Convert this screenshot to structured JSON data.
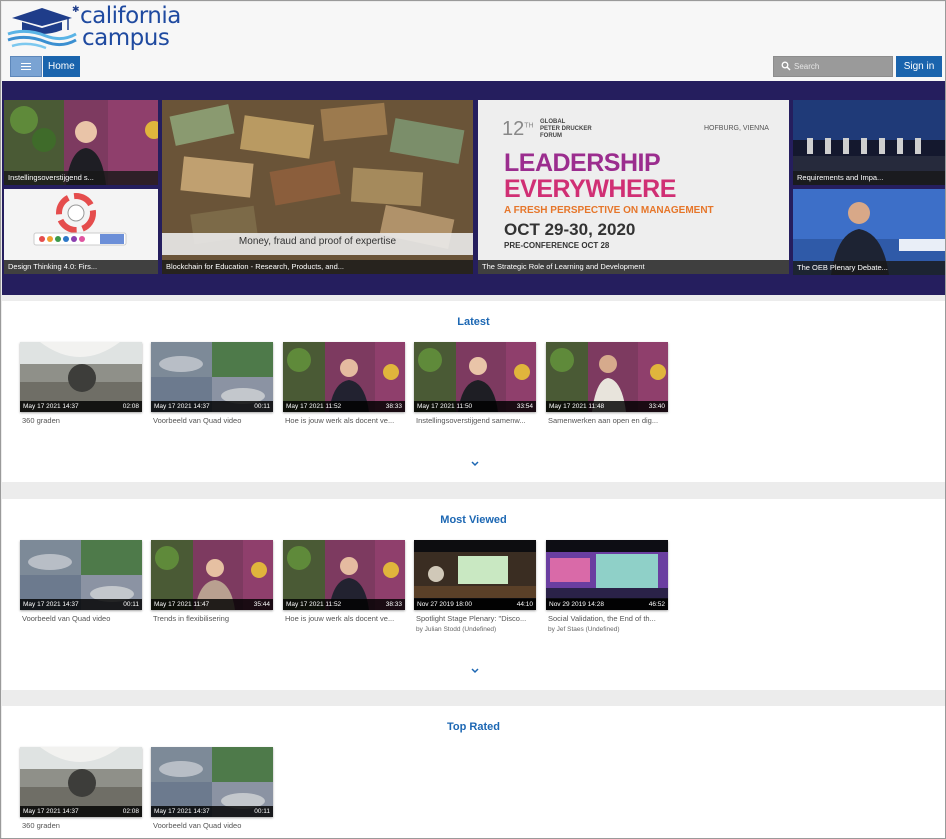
{
  "brand": {
    "line1": "california",
    "line2": "campus"
  },
  "nav": {
    "home": "Home",
    "sign_in": "Sign in",
    "search_placeholder": "Search"
  },
  "hero": {
    "tiles": [
      {
        "caption": "Instellingsoverstijgend s..."
      },
      {
        "caption": "Design Thinking 4.0: Firs..."
      },
      {
        "caption": "Blockchain for Education - Research, Products, and...",
        "overlay": "Money, fraud and proof of expertise"
      },
      {
        "caption": "The Strategic Role of Learning and Development",
        "poster": {
          "number": "12",
          "superscript": "TH",
          "org_lines": [
            "GLOBAL",
            "PETER DRUCKER",
            "FORUM"
          ],
          "location": "HOFBURG, VIENNA",
          "headline1": "LEADERSHIP",
          "headline2": "EVERYWHERE",
          "subhead": "A FRESH PERSPECTIVE ON MANAGEMENT",
          "dates": "OCT 29-30, 2020",
          "preconf": "PRE-CONFERENCE OCT 28"
        }
      },
      {
        "caption": "Requirements and Impa..."
      },
      {
        "caption": "The OEB Plenary Debate..."
      }
    ]
  },
  "sections": [
    {
      "title": "Latest",
      "cards": [
        {
          "date": "May 17 2021 14:37",
          "duration": "02:08",
          "title": "360 graden"
        },
        {
          "date": "May 17 2021 14:37",
          "duration": "00:11",
          "title": "Voorbeeld van Quad video"
        },
        {
          "date": "May 17 2021 11:52",
          "duration": "38:33",
          "title": "Hoe is jouw werk als docent ve..."
        },
        {
          "date": "May 17 2021 11:50",
          "duration": "33:54",
          "title": "Instellingsoverstijgend samenw..."
        },
        {
          "date": "May 17 2021 11:48",
          "duration": "33:40",
          "title": "Samenwerken aan open en dig..."
        }
      ]
    },
    {
      "title": "Most Viewed",
      "cards": [
        {
          "date": "May 17 2021 14:37",
          "duration": "00:11",
          "title": "Voorbeeld van Quad video"
        },
        {
          "date": "May 17 2021 11:47",
          "duration": "35:44",
          "title": "Trends in flexibilisering"
        },
        {
          "date": "May 17 2021 11:52",
          "duration": "38:33",
          "title": "Hoe is jouw werk als docent ve..."
        },
        {
          "date": "Nov 27 2019 18:00",
          "duration": "44:10",
          "title": "Spotlight Stage Plenary: \"Disco...",
          "by": "by Julian Stodd (Undefined)"
        },
        {
          "date": "Nov 29 2019 14:28",
          "duration": "46:52",
          "title": "Social Validation, the End of th...",
          "by": "by Jef Staes (Undefined)"
        }
      ]
    },
    {
      "title": "Top Rated",
      "cards": [
        {
          "date": "May 17 2021 14:37",
          "duration": "02:08",
          "title": "360 graden"
        },
        {
          "date": "May 17 2021 14:37",
          "duration": "00:11",
          "title": "Voorbeeld van Quad video"
        }
      ]
    }
  ]
}
